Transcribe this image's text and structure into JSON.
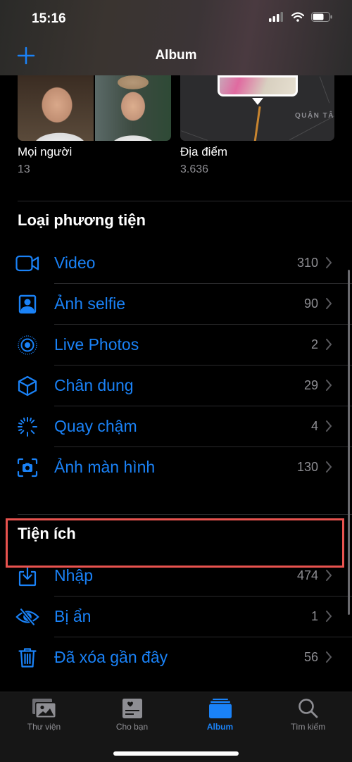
{
  "status_bar": {
    "time": "15:16",
    "signal_icon": "cellular-signal-icon",
    "wifi_icon": "wifi-icon",
    "battery_icon": "battery-icon"
  },
  "nav": {
    "title": "Album",
    "add_icon": "plus-icon"
  },
  "colors": {
    "accent": "#1a82f7",
    "secondary_text": "#8e8e93",
    "highlight_border": "#e8534f",
    "background": "#000000"
  },
  "people_places": {
    "people": {
      "label": "Mọi người",
      "count": "13"
    },
    "places": {
      "label": "Địa điểm",
      "count": "3.636",
      "map_label": "QUẬN TÂ"
    }
  },
  "media_types": {
    "title": "Loại phương tiện",
    "items": [
      {
        "label": "Video",
        "count": "310",
        "icon": "video-camera-icon"
      },
      {
        "label": "Ảnh selfie",
        "count": "90",
        "icon": "selfie-portrait-icon"
      },
      {
        "label": "Live Photos",
        "count": "2",
        "icon": "live-photos-icon"
      },
      {
        "label": "Chân dung",
        "count": "29",
        "icon": "cube-icon"
      },
      {
        "label": "Quay chậm",
        "count": "4",
        "icon": "slow-motion-icon"
      },
      {
        "label": "Ảnh màn hình",
        "count": "130",
        "icon": "screenshot-icon"
      }
    ]
  },
  "utilities": {
    "title": "Tiện ích",
    "items": [
      {
        "label": "Nhập",
        "count": "474",
        "icon": "import-icon"
      },
      {
        "label": "Bị ẩn",
        "count": "1",
        "icon": "hidden-eye-slash-icon",
        "highlighted": true
      },
      {
        "label": "Đã xóa gần đây",
        "count": "56",
        "icon": "trash-icon"
      }
    ]
  },
  "tabbar": {
    "tabs": [
      {
        "label": "Thư viện",
        "icon": "photo-library-icon",
        "active": false
      },
      {
        "label": "Cho bạn",
        "icon": "for-you-icon",
        "active": false
      },
      {
        "label": "Album",
        "icon": "album-stack-icon",
        "active": true
      },
      {
        "label": "Tìm kiếm",
        "icon": "search-icon",
        "active": false
      }
    ]
  }
}
